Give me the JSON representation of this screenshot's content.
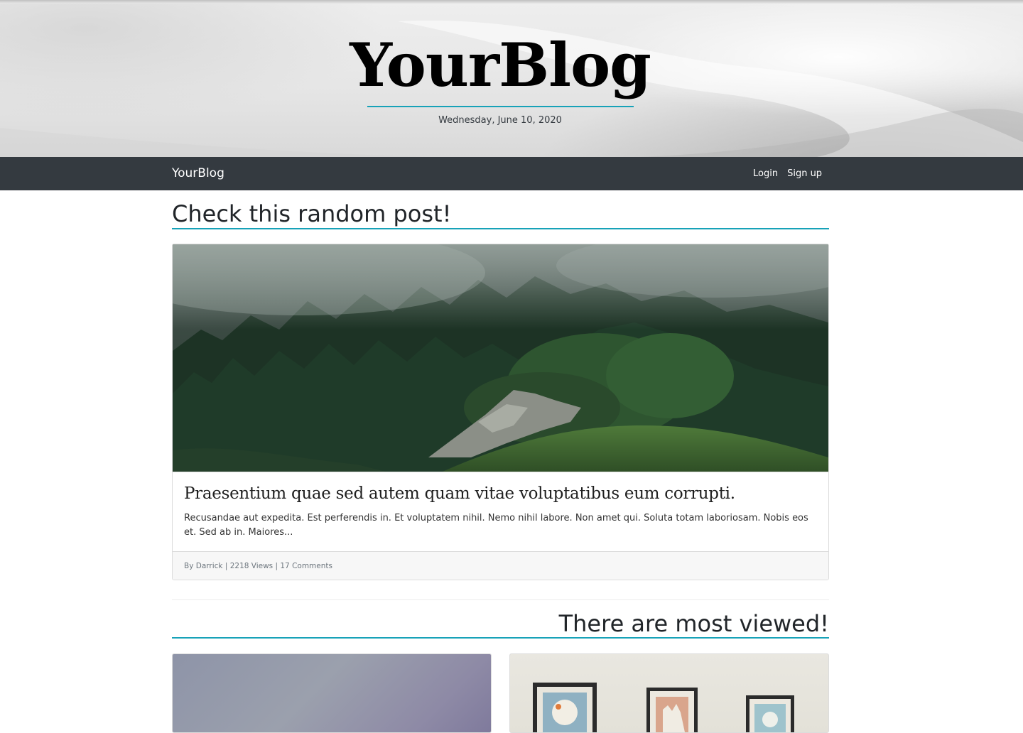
{
  "site": {
    "title": "YourBlog",
    "date": "Wednesday, June 10, 2020"
  },
  "navbar": {
    "brand": "YourBlog",
    "login": "Login",
    "signup": "Sign up"
  },
  "random_post": {
    "heading": "Check this random post!",
    "title": "Praesentium quae sed autem quam vitae voluptatibus eum corrupti.",
    "excerpt": "Recusandae aut expedita. Est perferendis in. Et voluptatem nihil. Nemo nihil labore. Non amet qui. Soluta totam laboriosam. Nobis eos et. Sed ab in. Maiores...",
    "meta": "By Darrick | 2218 Views | 17 Comments"
  },
  "most_viewed": {
    "heading": "There are most viewed!"
  },
  "colors": {
    "accent": "#17a2b8",
    "navbar": "#343a40"
  }
}
